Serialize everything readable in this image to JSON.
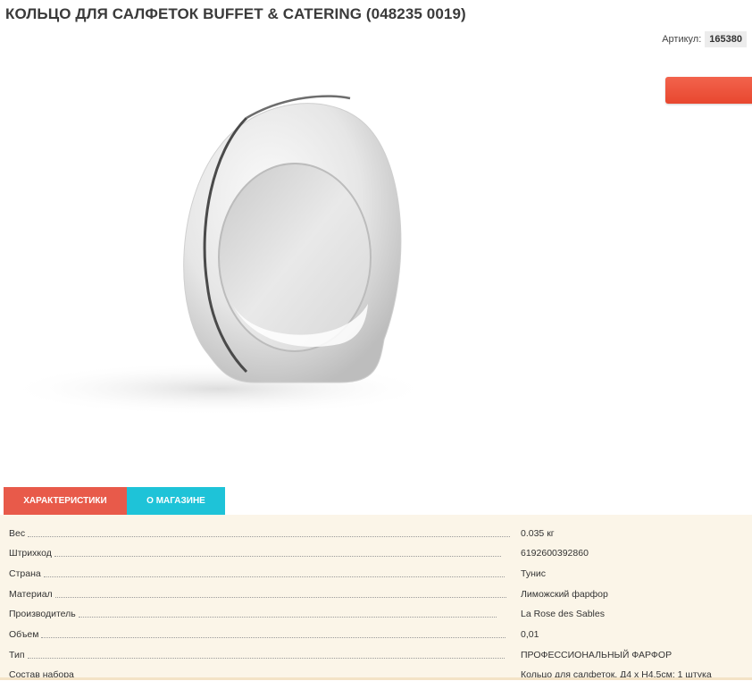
{
  "product": {
    "title": "КОЛЬЦО ДЛЯ САЛФЕТОК BUFFET & CATERING (048235 0019)",
    "sku_label": "Артикул:",
    "sku_value": "165380"
  },
  "tabs": [
    {
      "label": "ХАРАКТЕРИСТИКИ",
      "active": true
    },
    {
      "label": "О МАГАЗИНЕ",
      "active": false
    }
  ],
  "specs": [
    {
      "label": "Вес",
      "value": "0.035 кг"
    },
    {
      "label": "Штрихкод",
      "value": "6192600392860"
    },
    {
      "label": "Страна",
      "value": "Тунис"
    },
    {
      "label": "Материал",
      "value": "Лиможский фарфор"
    },
    {
      "label": "Производитель",
      "value": "La Rose des Sables"
    },
    {
      "label": "Объем",
      "value": "0,01"
    },
    {
      "label": "Тип",
      "value": "ПРОФЕССИОНАЛЬНЫЙ ФАРФОР"
    },
    {
      "label": "Состав набора",
      "value": "Кольцо для салфеток, Д4 х Н4,5см: 1 штука"
    }
  ],
  "colors": {
    "buy_button": "#e8472f",
    "tab_active": "#e85a4a",
    "tab_inactive": "#1ec3d8",
    "specs_background": "#fbf5e8"
  }
}
